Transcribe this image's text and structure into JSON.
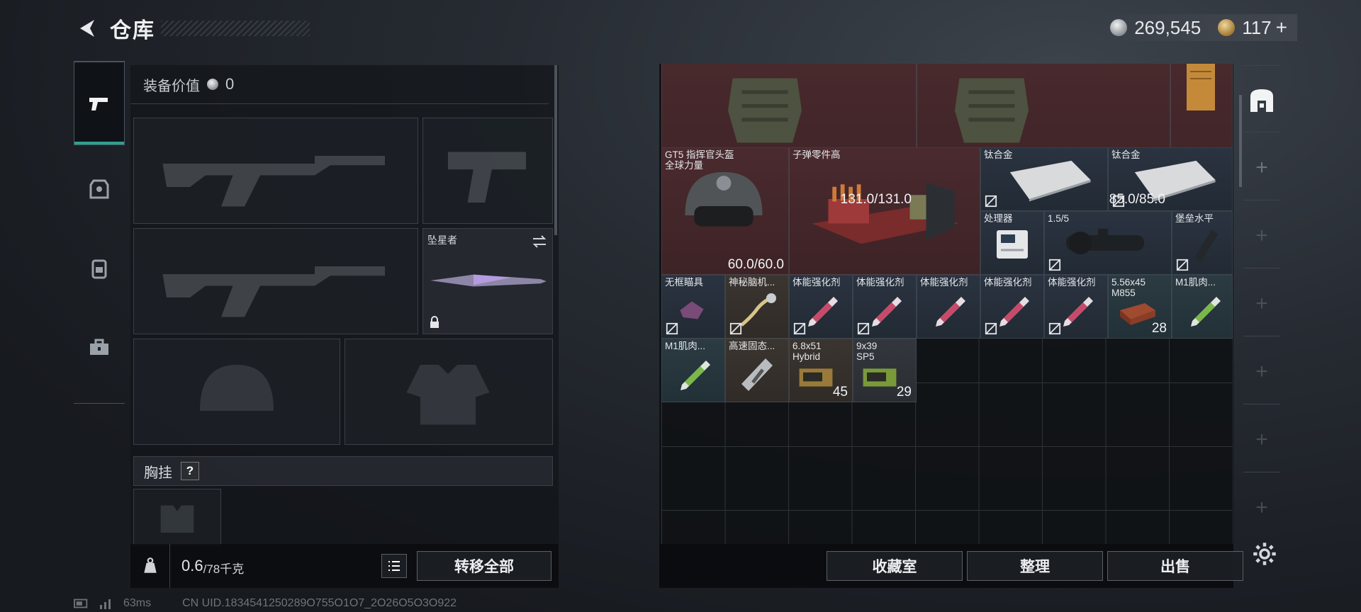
{
  "header": {
    "title": "仓库"
  },
  "currency": {
    "silver": "269,545",
    "gold": "117",
    "plus": "+"
  },
  "equipment": {
    "value_label": "装备价值",
    "value": "0",
    "melee_slot_name": "坠星者",
    "chest_rig_label": "胸挂",
    "help": "?",
    "weight_current": "0.6",
    "weight_max": "/78千克",
    "transfer_all": "转移全部"
  },
  "inventory": {
    "items": [
      {
        "name": "",
        "count": "131.0/131.0",
        "rarity": "red",
        "icon": "armor-vest-icon"
      },
      {
        "name": "",
        "count": "85.0/85.0",
        "rarity": "red",
        "icon": "armor-vest-icon"
      },
      {
        "name": "",
        "count": "",
        "rarity": "red",
        "icon": "document-icon"
      },
      {
        "name": "GT5 指挥官头盔\n全球力量",
        "count": "60.0/60.0",
        "rarity": "red",
        "icon": "helmet-icon"
      },
      {
        "name": "子弹零件高",
        "count": "",
        "rarity": "red",
        "icon": "ammo-parts-box-icon"
      },
      {
        "name": "钛合金",
        "count": "",
        "rarity": "blue",
        "icon": "metal-plate-icon"
      },
      {
        "name": "钛合金",
        "count": "",
        "rarity": "blue",
        "icon": "metal-plate-icon"
      },
      {
        "name": "处理器",
        "count": "",
        "rarity": "blue",
        "icon": "processor-icon"
      },
      {
        "name": "1.5/5",
        "count": "",
        "rarity": "blue",
        "icon": "scope-icon"
      },
      {
        "name": "堡垒水平",
        "count": "",
        "rarity": "blue",
        "icon": "grip-icon"
      },
      {
        "name": "无框瞄具",
        "count": "",
        "rarity": "blue",
        "icon": "sight-icon"
      },
      {
        "name": "神秘脑机...",
        "count": "",
        "rarity": "brown",
        "icon": "brain-chip-icon"
      },
      {
        "name": "体能强化剂",
        "count": "",
        "rarity": "blue",
        "icon": "syringe-icon"
      },
      {
        "name": "体能强化剂",
        "count": "",
        "rarity": "blue",
        "icon": "syringe-icon"
      },
      {
        "name": "体能强化剂",
        "count": "",
        "rarity": "blue",
        "icon": "syringe-icon"
      },
      {
        "name": "体能强化剂",
        "count": "",
        "rarity": "blue",
        "icon": "syringe-icon"
      },
      {
        "name": "体能强化剂",
        "count": "",
        "rarity": "blue",
        "icon": "syringe-icon"
      },
      {
        "name": "5.56x45\nM855",
        "count": "28",
        "rarity": "teal",
        "icon": "ammo-box-icon"
      },
      {
        "name": "M1肌肉...",
        "count": "",
        "rarity": "teal",
        "icon": "green-syringe-icon"
      },
      {
        "name": "M1肌肉...",
        "count": "",
        "rarity": "teal",
        "icon": "green-syringe-icon"
      },
      {
        "name": "高速固态...",
        "count": "",
        "rarity": "brown",
        "icon": "ssd-icon"
      },
      {
        "name": "6.8x51\nHybrid",
        "count": "45",
        "rarity": "brown",
        "icon": "ammo-box-icon"
      },
      {
        "name": "9x39\nSP5",
        "count": "29",
        "rarity": "gray",
        "icon": "ammo-box-icon"
      }
    ]
  },
  "actions": {
    "collection": "收藏室",
    "sort": "整理",
    "sell": "出售"
  },
  "status": {
    "ping": "63ms",
    "uid": "CN UID.1834541250289O755O1O7_2O26O5O3O922"
  }
}
